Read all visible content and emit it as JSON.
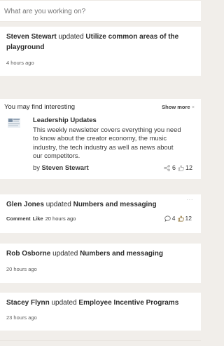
{
  "search": {
    "placeholder": "What are you working on?"
  },
  "posts": [
    {
      "author": "Steven Stewart",
      "verb": "updated",
      "target": "Utilize common areas of the playground",
      "time": "4 hours ago"
    },
    {
      "author": "Glen Jones",
      "verb": "updated",
      "target": "Numbers and messaging",
      "time": "20 hours ago",
      "comment_label": "Comment",
      "like_label": "Like",
      "comments": "4",
      "likes": "12",
      "menu": "···"
    },
    {
      "author": "Rob Osborne",
      "verb": "updated",
      "target": "Numbers and messaging",
      "time": "20 hours ago"
    },
    {
      "author": "Stacey Flynn",
      "verb": "updated",
      "target": "Employee Incentive Programs",
      "time": "23 hours ago"
    }
  ],
  "recommendations": {
    "heading": "You may find interesting",
    "show_more": "Show more",
    "close": "×",
    "item": {
      "title": "Leadership Updates",
      "description": "This weekly newsletter covers everything you need to know about the creator economy, the music industry, the tech industry as well as news about our competitors.",
      "by_label": "by",
      "author": "Steven Stewart",
      "shares": "6",
      "likes": "12"
    }
  },
  "icons": [
    "share-icon",
    "thumbs-up-icon",
    "comment-icon",
    "newsletter-thumbnail"
  ],
  "colors": {
    "background": "#f1eeea",
    "card": "#ffffff",
    "text": "#2b2b2b"
  }
}
